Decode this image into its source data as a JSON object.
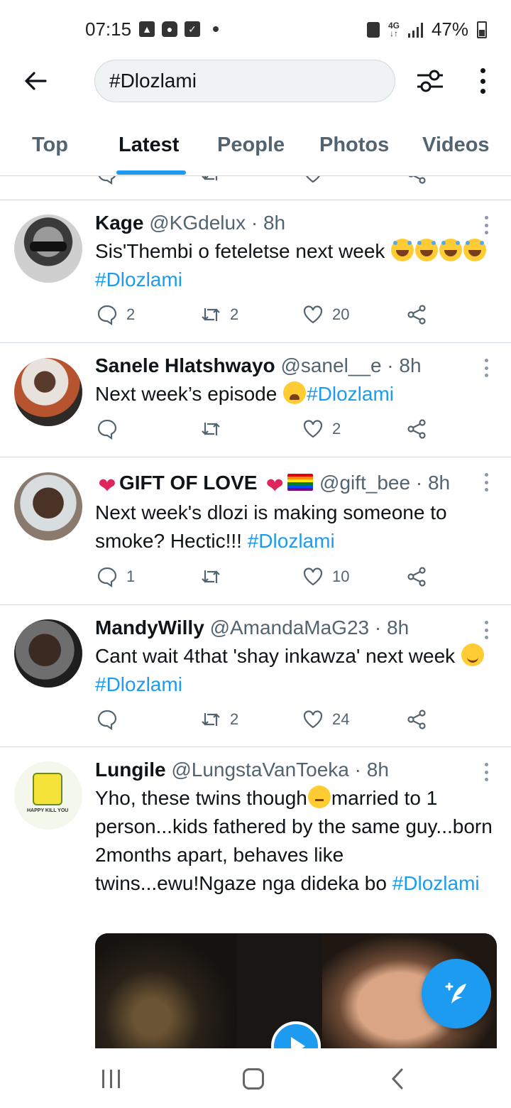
{
  "status_bar": {
    "time": "07:15",
    "battery": "47%",
    "network": "4G"
  },
  "search": {
    "query": "#Dlozlami"
  },
  "tabs": [
    "Top",
    "Latest",
    "People",
    "Photos",
    "Videos"
  ],
  "active_tab": "Latest",
  "tweets": [
    {
      "name": "Kage",
      "handle": "@KGdelux",
      "time": "· 8h",
      "text_parts": [
        "Sis'Thembi o feteletse next week "
      ],
      "hashtag": "#Dlozlami",
      "replies": "2",
      "retweets": "2",
      "likes": "20"
    },
    {
      "name": "Sanele Hlatshwayo",
      "handle": "@sanel__e",
      "time": "· 8h",
      "text_parts": [
        "Next week’s episode "
      ],
      "hashtag": "#Dlozlami",
      "replies": "",
      "retweets": "",
      "likes": "2"
    },
    {
      "name": "GIFT OF LOVE",
      "handle": "@gift_bee",
      "time": "· 8h",
      "text_parts": [
        "Next week's dlozi is making someone to smoke? Hectic!!! "
      ],
      "hashtag": "#Dlozlami",
      "replies": "1",
      "retweets": "",
      "likes": "10"
    },
    {
      "name": "MandyWilly",
      "handle": "@AmandaMaG23",
      "time": "· 8h",
      "text_parts": [
        "Cant wait 4that 'shay inkawza' next week "
      ],
      "hashtag": "#Dlozlami",
      "replies": "",
      "retweets": "2",
      "likes": "24"
    },
    {
      "name": "Lungile",
      "handle": "@LungstaVanToeka",
      "time": "· 8h",
      "text_parts": [
        "Yho, these twins though",
        "married to 1 person...kids fathered by the same guy...born 2months apart, behaves like twins...ewu!Ngaze nga dideka bo "
      ],
      "hashtag": "#Dlozlami",
      "avatar_caption": "HAPPY KILL YOU"
    }
  ],
  "colors": {
    "accent": "#1d9bf0",
    "text": "#0f1419",
    "muted": "#536471",
    "divider": "#cfd9de"
  }
}
